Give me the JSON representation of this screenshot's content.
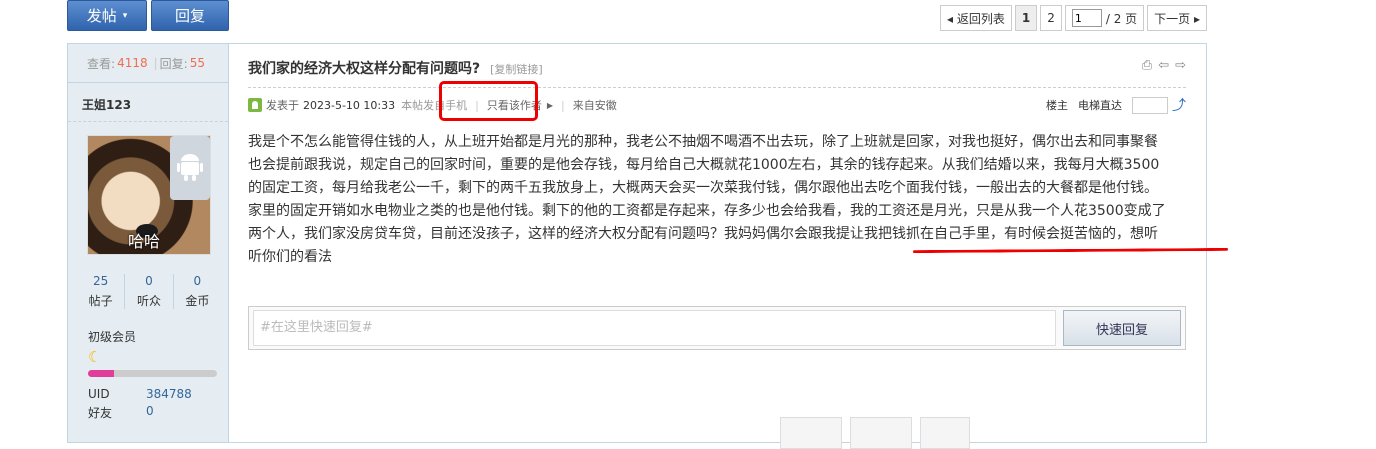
{
  "toolbar": {
    "post_label": "发帖",
    "post_caret": "▾",
    "reply_label": "回复"
  },
  "pager": {
    "back": "◂ 返回列表",
    "pages": [
      "1",
      "2"
    ],
    "current_value": "1",
    "total": "/ 2 页",
    "next": "下一页 ▸"
  },
  "sidebar": {
    "views_label": "查看:",
    "views": "4118",
    "sep": "|",
    "replies_label": "回复:",
    "replies": "55",
    "username": "王姐123",
    "avatar_caption": "哈哈",
    "counts": [
      {
        "value": "25",
        "label": "帖子"
      },
      {
        "value": "0",
        "label": "听众"
      },
      {
        "value": "0",
        "label": "金币"
      }
    ],
    "level": "初级会员",
    "level_progress": 0.2,
    "info": [
      {
        "key": "UID",
        "value": "384788"
      },
      {
        "key": "好友",
        "value": "0"
      }
    ]
  },
  "post": {
    "title": "我们家的经济大权这样分配有问题吗?",
    "copy_link": "[复制链接]",
    "posted_prefix": "发表于",
    "time": "2023-5-10 10:33",
    "device": "本帖发自手机",
    "author_only": "只看该作者",
    "location": "来自安徽",
    "floor": "楼主",
    "elevator": "电梯直达",
    "content": "我是个不怎么能管得住钱的人，从上班开始都是月光的那种，我老公不抽烟不喝酒不出去玩，除了上班就是回家，对我也挺好，偶尔出去和同事聚餐也会提前跟我说，规定自己的回家时间，重要的是他会存钱，每月给自己大概就花1000左右，其余的钱存起来。从我们结婚以来，我每月大概3500的固定工资，每月给我老公一千，剩下的两千五我放身上，大概两天会买一次菜我付钱，偶尔跟他出去吃个面我付钱，一般出去的大餐都是他付钱。家里的固定开销如水电物业之类的也是他付钱。剩下的他的工资都是存起来，存多少也会给我看，我的工资还是月光，只是从我一个人花3500变成了两个人，我们家没房贷车贷，目前还没孩子，这样的经济大权分配有问题吗？我妈妈偶尔会跟我提让我把钱抓在自己手里，有时候会挺苦恼的，想听听你们的看法"
  },
  "quick_reply": {
    "placeholder": "#在这里快速回复#",
    "button": "快速回复"
  },
  "colors": {
    "accent": "#2f63ac",
    "highlight": "#e00000",
    "count": "#f26c4f"
  }
}
